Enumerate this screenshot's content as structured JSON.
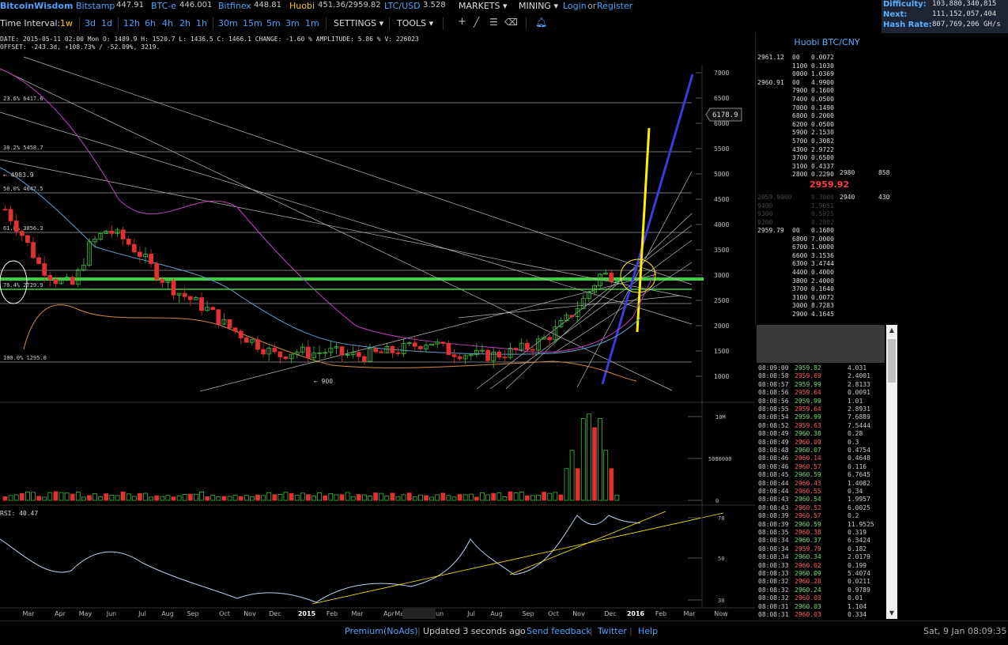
{
  "topbar": {
    "logo": "BitcoinWisdom",
    "exchanges": [
      {
        "name": "Bitstamp",
        "price": "447.91"
      },
      {
        "name": "BTC-e",
        "price": "446.001"
      },
      {
        "name": "Bitfinex",
        "price": "448.81"
      },
      {
        "name": "Huobi",
        "price": "451.36/2959.82"
      },
      {
        "name": "LTC/USD",
        "price": "3.528"
      }
    ],
    "markets": "MARKETS",
    "mining": "MINING",
    "login": "Login",
    "or": "or",
    "register": "Register"
  },
  "network": {
    "difficulty_label": "Difficulty:",
    "difficulty": "103,880,340,815",
    "next_label": "Next:",
    "next": "111,152,057,404",
    "hashrate_label": "Hash Rate:",
    "hashrate": "807,769,206 GH/s"
  },
  "toolbar": {
    "interval_label": "Time Interval:",
    "intervals": [
      "1w",
      "3d",
      "1d",
      "12h",
      "6h",
      "4h",
      "2h",
      "1h",
      "30m",
      "15m",
      "5m",
      "3m",
      "1m"
    ],
    "active_interval": "1w",
    "settings": "SETTINGS",
    "tools": "TOOLS"
  },
  "info": {
    "line1": "DATE: 2015-05-11 02:00 Mon    O: 1489.9    H: 1520.7    L: 1436.5    C: 1466.1    CHANGE: -1.60 %    AMPLITUDE: 5.86 %    V: 226023",
    "line2": "OFFSET: -243.3d, +108.73% / -52.09%, 3219."
  },
  "chart": {
    "price_ticks": [
      "7000",
      "6500",
      "6000",
      "5500",
      "5000",
      "4500",
      "4000",
      "3500",
      "3000",
      "2500",
      "2000",
      "1500",
      "1000"
    ],
    "current_price_label": "6178.9",
    "fib_labels": [
      "23.6% 6417.6",
      "38.2% 5458.7",
      "50.0% 4647.5",
      "61.8% 3856.3",
      "76.4% 2729.9",
      "100.0% 1295.0"
    ],
    "high_label": "← 4983.9",
    "low_label": "← 900",
    "volume_ticks": [
      "10M",
      "5000000",
      "0"
    ],
    "rsi_label": "RSI: 40.47",
    "rsi_ticks": [
      "70",
      "50",
      "30"
    ],
    "x_labels": [
      "Mar",
      "Apr",
      "May",
      "Jun",
      "Jul",
      "Aug",
      "Sep",
      "Oct",
      "Nov",
      "Dec",
      "2015",
      "Feb",
      "Mar",
      "Apr",
      "May 11",
      "Jun",
      "Jul",
      "Aug",
      "Sep",
      "Oct",
      "Nov",
      "Dec",
      "2016",
      "Feb",
      "Mar",
      "Now"
    ],
    "colors": {
      "up": "#3cbf3c",
      "down": "#e03030",
      "fib": "#888888",
      "support": "#3ccf3c",
      "yellow": "#ffee00",
      "blue": "#3b3bdd"
    }
  },
  "orderbook": {
    "title": "Huobi BTC/CNY",
    "asks": [
      [
        "2961.12",
        "00",
        "0.0072"
      ],
      [
        "",
        "1100",
        "0.1030"
      ],
      [
        "",
        "0000",
        "1.0369"
      ],
      [
        "2960.91",
        "00",
        "4.9900"
      ],
      [
        "",
        "7900",
        "0.1600"
      ],
      [
        "",
        "7400",
        "0.0500"
      ],
      [
        "",
        "7000",
        "0.1490"
      ],
      [
        "",
        "6800",
        "0.2000"
      ],
      [
        "",
        "6200",
        "0.0500"
      ],
      [
        "",
        "5900",
        "2.1530"
      ],
      [
        "",
        "5700",
        "0.3082"
      ],
      [
        "",
        "4300",
        "2.9722"
      ],
      [
        "",
        "3700",
        "0.6500"
      ],
      [
        "",
        "3100",
        "0.4337"
      ],
      [
        "",
        "2800",
        "0.2290"
      ]
    ],
    "ask_side": [
      "2980",
      "858"
    ],
    "last_price": "2959.92",
    "bid_side": [
      "2940",
      "430"
    ],
    "faded": [
      [
        "2959.9900",
        "0.3000"
      ],
      [
        "9400",
        "1.9051"
      ],
      [
        "9300",
        "0.5925"
      ],
      [
        "9200",
        "0.2892"
      ]
    ],
    "bids": [
      [
        "2959.79",
        "00",
        "0.1600"
      ],
      [
        "",
        "6800",
        "7.0000"
      ],
      [
        "",
        "6700",
        "1.0000"
      ],
      [
        "",
        "6600",
        "3.1536"
      ],
      [
        "",
        "6300",
        "3.4744"
      ],
      [
        "",
        "4400",
        "0.4000"
      ],
      [
        "",
        "3800",
        "2.4000"
      ],
      [
        "",
        "3700",
        "0.1640"
      ],
      [
        "",
        "3100",
        "0.0072"
      ],
      [
        "",
        "3000",
        "8.7283"
      ],
      [
        "",
        "2900",
        "4.1645"
      ]
    ]
  },
  "trades": [
    [
      "08:09:00",
      "2959.82",
      "4.031",
      "up"
    ],
    [
      "08:08:58",
      "2959.69",
      "2.4001",
      "down"
    ],
    [
      "08:08:57",
      "2959.99",
      "2.8133",
      "up"
    ],
    [
      "08:08:56",
      "2959.64",
      "0.0091",
      "down"
    ],
    [
      "08:08:56",
      "2959.99",
      "1.01",
      "up"
    ],
    [
      "08:08:55",
      "2959.64",
      "2.8931",
      "down"
    ],
    [
      "08:08:54",
      "2959.99",
      "7.6889",
      "up"
    ],
    [
      "08:08:52",
      "2959.63",
      "7.5444",
      "down"
    ],
    [
      "08:08:49",
      "2960.38",
      "0.28",
      "up"
    ],
    [
      "08:08:49",
      "2960.09",
      "0.3",
      "down"
    ],
    [
      "08:08:48",
      "2960.07",
      "0.4754",
      "up"
    ],
    [
      "08:08:46",
      "2960.14",
      "0.4648",
      "down"
    ],
    [
      "08:08:46",
      "2960.57",
      "0.116",
      "down"
    ],
    [
      "08:08:45",
      "2960.59",
      "6.7645",
      "up"
    ],
    [
      "08:08:44",
      "2960.43",
      "1.4082",
      "down"
    ],
    [
      "08:08:44",
      "2960.55",
      "0.34",
      "down"
    ],
    [
      "08:08:43",
      "2960.54",
      "1.9957",
      "up"
    ],
    [
      "08:08:43",
      "2960.52",
      "6.0025",
      "down"
    ],
    [
      "08:08:39",
      "2960.57",
      "0.2",
      "down"
    ],
    [
      "08:08:39",
      "2960.59",
      "11.9525",
      "up"
    ],
    [
      "08:08:35",
      "2960.38",
      "0.319",
      "down"
    ],
    [
      "08:08:34",
      "2960.37",
      "6.3424",
      "up"
    ],
    [
      "08:08:34",
      "2959.79",
      "0.182",
      "down"
    ],
    [
      "08:08:34",
      "2960.34",
      "2.0179",
      "up"
    ],
    [
      "08:08:33",
      "2960.02",
      "0.199",
      "down"
    ],
    [
      "08:08:33",
      "2960.09",
      "5.4074",
      "up"
    ],
    [
      "08:08:32",
      "2960.28",
      "0.0211",
      "down"
    ],
    [
      "08:08:32",
      "2960.24",
      "0.9789",
      "up"
    ],
    [
      "08:08:32",
      "2960.03",
      "0.01",
      "down"
    ],
    [
      "08:08:31",
      "2960.03",
      "1.104",
      "up"
    ],
    [
      "08:08:31",
      "2960.03",
      "0.334",
      "down"
    ]
  ],
  "footer": {
    "premium": "Premium(NoAds)",
    "updated": "Updated 3 seconds ago",
    "feedback": "Send feedback",
    "twitter": "Twitter",
    "help": "Help",
    "datetime": "Sat, 9 Jan 08:09:35"
  }
}
